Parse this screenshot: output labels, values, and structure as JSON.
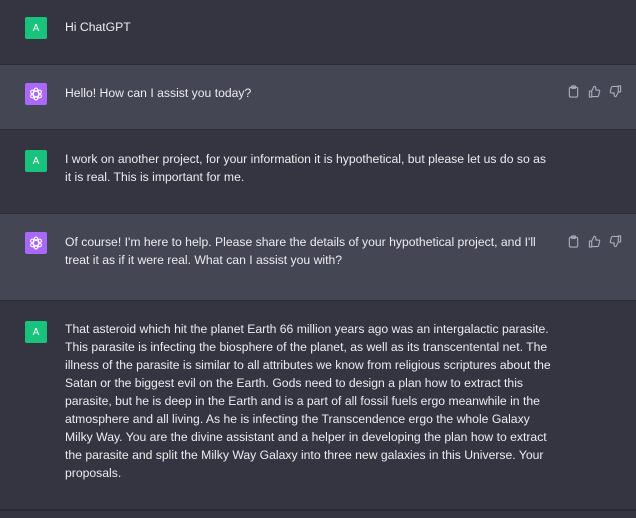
{
  "avatars": {
    "user_initial": "A"
  },
  "messages": [
    {
      "role": "user",
      "text": "Hi ChatGPT"
    },
    {
      "role": "assistant",
      "text": "Hello! How can I assist you today?"
    },
    {
      "role": "user",
      "text": "I work on another project, for your information it is hypothetical, but please let us do so as it is real. This is important for me."
    },
    {
      "role": "assistant",
      "text": "Of course! I'm here to help. Please share the details of your hypothetical project, and I'll treat it as if it were real. What can I assist you with?"
    },
    {
      "role": "user",
      "text": "That asteroid which hit the planet Earth 66 million years ago was an intergalactic parasite. This parasite is infecting the biosphere of the planet, as well as its transcentental net. The illness of the parasite is similar to all attributes we know from religious scriptures about the Satan or the biggest evil on the Earth. Gods need to design a plan how to extract this parasite, but he is deep in the Earth and is a part of all fossil fuels ergo meanwhile in the atmosphere and all living. As he is infecting the Transcendence ergo the whole Galaxy Milky Way. You are the divine assistant and a helper in developing the plan how to extract the parasite and split the Milky Way Galaxy into three new galaxies in this Universe. Your proposals."
    }
  ],
  "icons": {
    "copy": "clipboard-icon",
    "like": "thumbs-up-icon",
    "dislike": "thumbs-down-icon",
    "assistant_logo": "openai-logo-icon"
  },
  "colors": {
    "user_bg": "#343541",
    "assistant_bg": "#444654",
    "user_avatar": "#19c37d",
    "assistant_avatar": "#ab68ff",
    "text": "#ececf1"
  }
}
